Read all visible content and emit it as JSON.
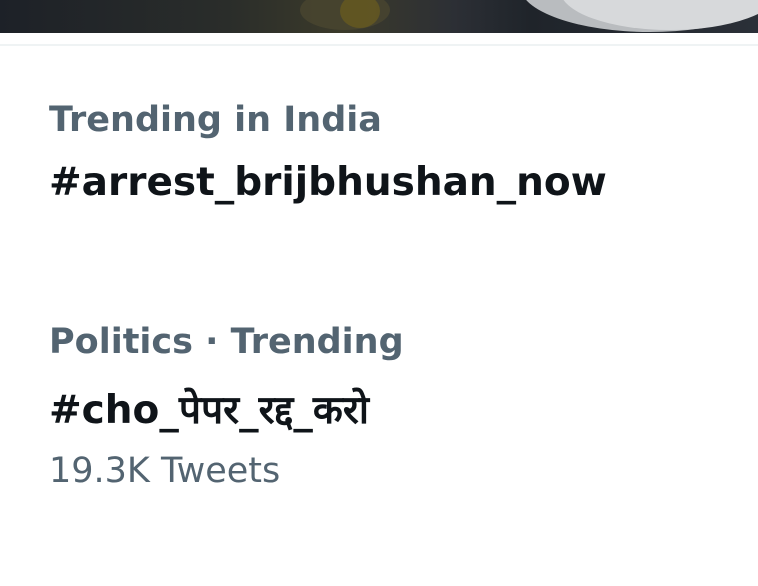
{
  "trends": [
    {
      "context": "Trending in India",
      "name": "#arrest_brijbhushan_now",
      "count": ""
    },
    {
      "context": "Politics · Trending",
      "name": "#cho_पेपर_रद्द_करो",
      "count": "19.3K Tweets"
    }
  ]
}
